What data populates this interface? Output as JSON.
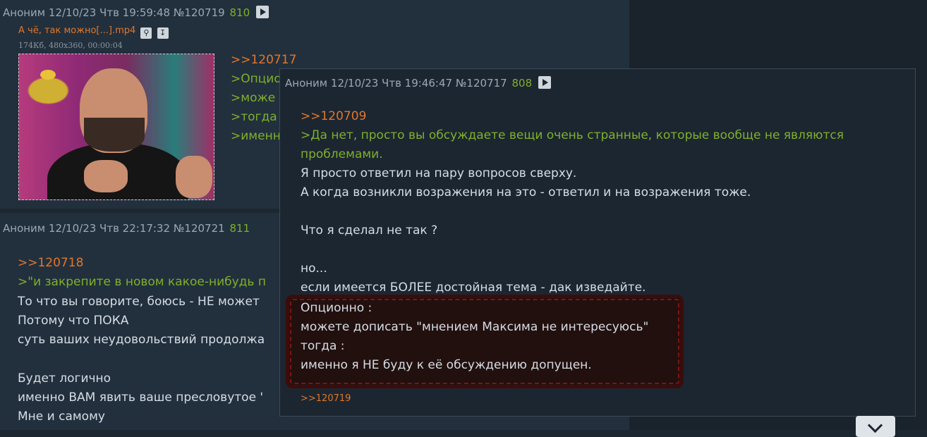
{
  "post1": {
    "author": "Аноним",
    "date": "12/10/23 Чтв 19:59:48",
    "id": "№120719",
    "num": "810",
    "file_name": "А чё, так можно[...].mp4",
    "file_meta": "174Кб, 480x360, 00:00:04",
    "lines": [
      ">>120717",
      ">Опцио",
      ">може",
      ">тогда",
      ">именн"
    ]
  },
  "post2": {
    "author": "Аноним",
    "date": "12/10/23 Чтв 22:17:32",
    "id": "№120721",
    "num": "811",
    "lines": [
      ">>120718",
      ">\"и закрепите в новом какое-нибудь п",
      "То что вы говорите, боюсь - НЕ может",
      "Потому что ПОКА",
      "суть ваших неудовольствий продолжа",
      "",
      "Будет логично",
      "именно ВАМ явить ваше пресловутое '",
      "Мне и самому"
    ]
  },
  "popup": {
    "author": "Аноним",
    "date": "12/10/23 Чтв 19:46:47",
    "id": "№120717",
    "num": "808",
    "lines": [
      ">>120709",
      ">Да нет, просто вы обсуждаете вещи очень странные, которые вообще не являются",
      "проблемами.",
      "Я просто ответил на пару вопросов сверху.",
      "А когда возникли возражения на это - ответил и на возражения тоже.",
      "",
      "Что я сделал не так ?",
      "",
      "но...",
      "если имеется БОЛЕЕ достойная тема - дак изведайте."
    ],
    "highlight": [
      "Опционно :",
      "можете дописать \"мнением Максима не интересуюсь\"",
      "тогда :",
      "именно я НЕ буду к её обсуждению допущен."
    ],
    "reply": ">>120719"
  }
}
